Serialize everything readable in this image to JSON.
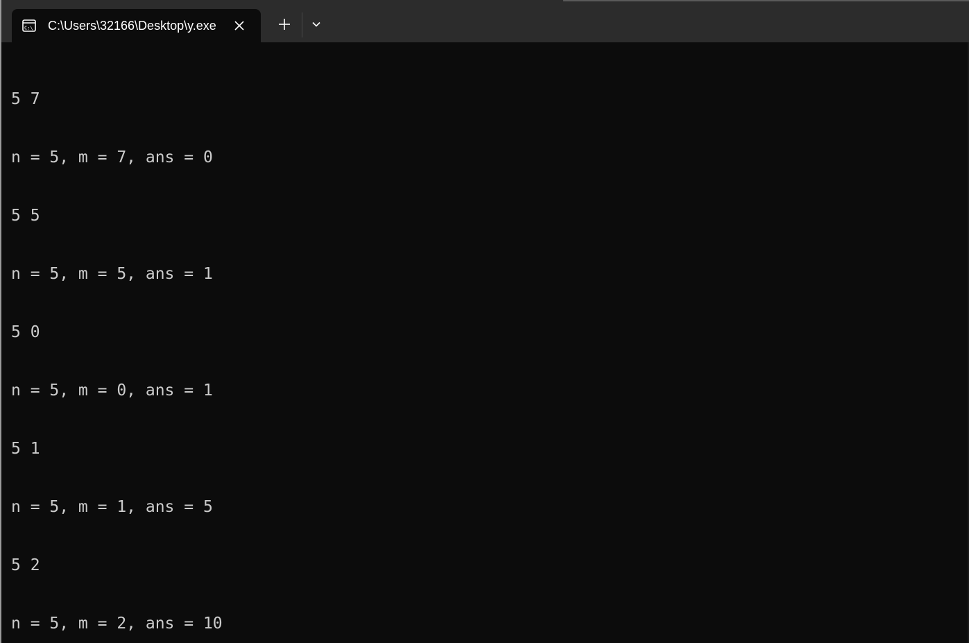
{
  "window": {
    "tab_title": "C:\\Users\\32166\\Desktop\\y.exe",
    "tab_icon": "console-icon",
    "close_icon": "close-icon",
    "new_tab_icon": "plus-icon",
    "dropdown_icon": "chevron-down-icon"
  },
  "terminal": {
    "lines": [
      "5 7",
      "n = 5, m = 7, ans = 0",
      "5 5",
      "n = 5, m = 5, ans = 1",
      "5 0",
      "n = 5, m = 0, ans = 1",
      "5 1",
      "n = 5, m = 1, ans = 5",
      "5 2",
      "n = 5, m = 2, ans = 10"
    ]
  },
  "colors": {
    "background": "#0c0c0c",
    "titlebar": "#2c2c2c",
    "text": "#cccccc",
    "tab_text": "#ffffff"
  }
}
